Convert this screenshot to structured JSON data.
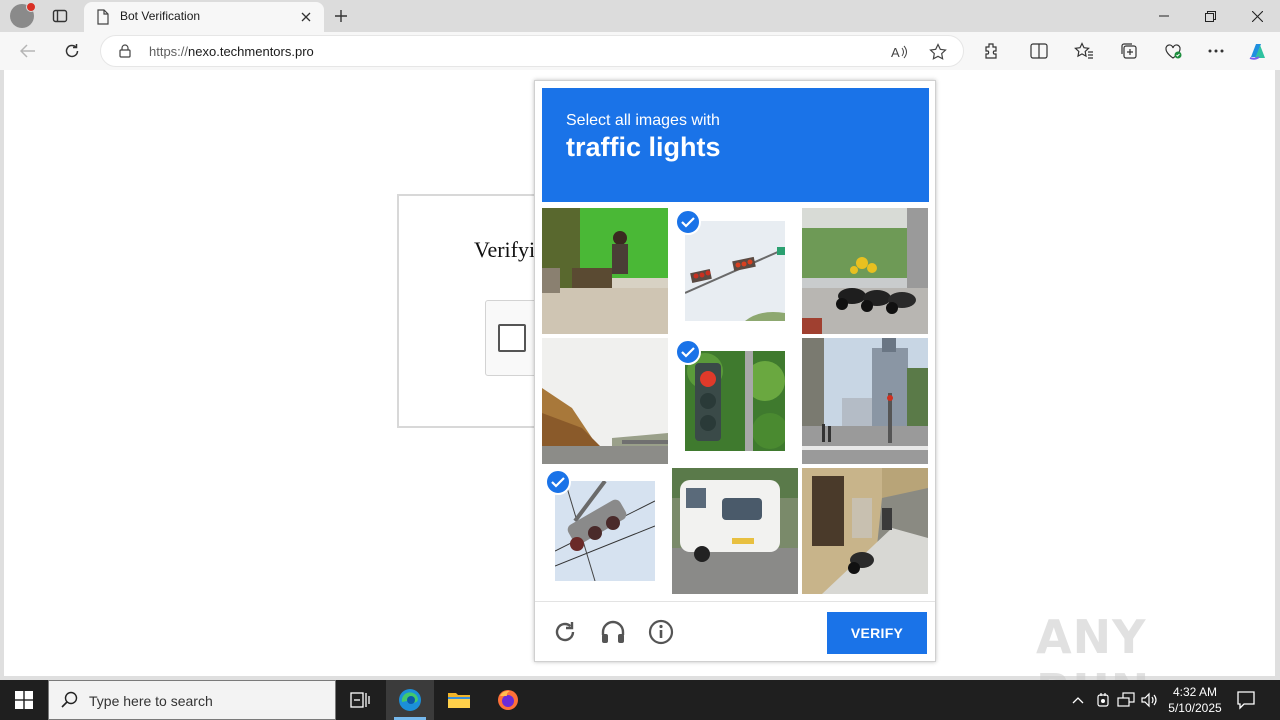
{
  "browser": {
    "tab_title": "Bot Verification",
    "url_proto": "https://",
    "url_host": "nexo.techmentors.pro"
  },
  "page": {
    "heading": "Verifyi",
    "watermark": "ANY RUN"
  },
  "captcha": {
    "instruction": "Select all images with",
    "object": "traffic lights",
    "verify_label": "VERIFY",
    "tiles": [
      {
        "scene": "person-under-shelter",
        "selected": false
      },
      {
        "scene": "traffic-light-overhead",
        "selected": true
      },
      {
        "scene": "parked-motorcycles",
        "selected": false
      },
      {
        "scene": "highway-hills",
        "selected": false
      },
      {
        "scene": "traffic-light-pole",
        "selected": true
      },
      {
        "scene": "city-crosswalk",
        "selected": false
      },
      {
        "scene": "traffic-light-wires",
        "selected": true
      },
      {
        "scene": "white-caravan",
        "selected": false
      },
      {
        "scene": "scooter-building",
        "selected": false
      }
    ]
  },
  "taskbar": {
    "search_placeholder": "Type here to search",
    "time": "4:32 AM",
    "date": "5/10/2025"
  }
}
